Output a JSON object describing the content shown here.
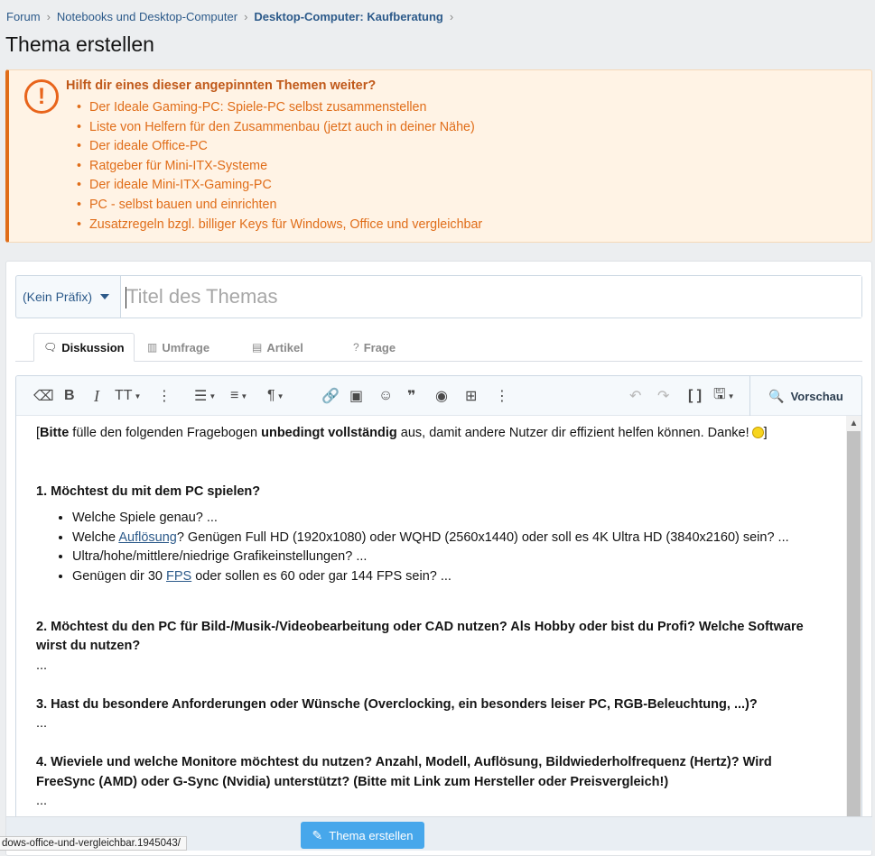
{
  "breadcrumb": {
    "items": [
      "Forum",
      "Notebooks und Desktop-Computer"
    ],
    "current": "Desktop-Computer: Kaufberatung",
    "separator": "›"
  },
  "page_title": "Thema erstellen",
  "notice": {
    "icon": "exclamation-circle-icon",
    "title": "Hilft dir eines dieser angepinnten Themen weiter?",
    "links": [
      "Der Ideale Gaming-PC: Spiele-PC selbst zusammenstellen",
      "Liste von Helfern für den Zusammenbau (jetzt auch in deiner Nähe)",
      "Der ideale Office-PC",
      "Ratgeber für Mini-ITX-Systeme",
      "Der ideale Mini-ITX-Gaming-PC",
      "PC - selbst bauen und einrichten",
      "Zusatzregeln bzgl. billiger Keys für Windows, Office und vergleichbar"
    ],
    "accent_color": "#e06d19"
  },
  "form": {
    "prefix_label": "(Kein Präfix)",
    "title_placeholder": "Titel des Themas",
    "title_value": ""
  },
  "tabs": [
    {
      "label": "Diskussion",
      "icon": "discussion-icon",
      "active": true
    },
    {
      "label": "Umfrage",
      "icon": "poll-icon",
      "active": false
    },
    {
      "label": "Artikel",
      "icon": "article-icon",
      "active": false
    },
    {
      "label": "Frage",
      "icon": "question-icon",
      "active": false
    }
  ],
  "toolbar": {
    "preview_label": "Vorschau"
  },
  "content": {
    "intro_bracket_open": "[",
    "intro_bold1": "Bitte",
    "intro_text1": " fülle den folgenden Fragebogen ",
    "intro_bold2": "unbedingt vollständig",
    "intro_text2": " aus, damit andere Nutzer dir effizient helfen können. Danke!",
    "intro_bracket_close": "]",
    "q1": "1. Möchtest du mit dem PC spielen?",
    "q1_items": {
      "item1": "Welche Spiele genau? ...",
      "item2_pre": "Welche ",
      "item2_link": "Auflösung",
      "item2_post": "? Genügen Full HD (1920x1080) oder WQHD (2560x1440) oder soll es 4K Ultra HD (3840x2160) sein? ...",
      "item3": "Ultra/hohe/mittlere/niedrige Grafikeinstellungen? ...",
      "item4_pre": "Genügen dir 30 ",
      "item4_link": "FPS",
      "item4_post": " oder sollen es 60 oder gar 144 FPS sein? ..."
    },
    "q2": "2. Möchtest du den PC für Bild-/Musik-/Videobearbeitung oder CAD nutzen? Als Hobby oder bist du Profi? Welche Software wirst du nutzen?",
    "q2_answer": "...",
    "q3": "3. Hast du besondere Anforderungen oder Wünsche (Overclocking, ein besonders leiser PC, RGB-Beleuchtung, ...)?",
    "q3_answer": "...",
    "q4": "4. Wieviele und welche Monitore möchtest du nutzen? Anzahl, Modell, Auflösung, Bildwiederholfrequenz (Hertz)? Wird FreeSync (AMD) oder G-Sync (Nvidia) unterstützt? (Bitte mit Link zum Hersteller oder Preisvergleich!)",
    "q4_answer": "..."
  },
  "submit_label": "Thema erstellen",
  "status_url": "dows-office-und-vergleichbar.1945043/"
}
